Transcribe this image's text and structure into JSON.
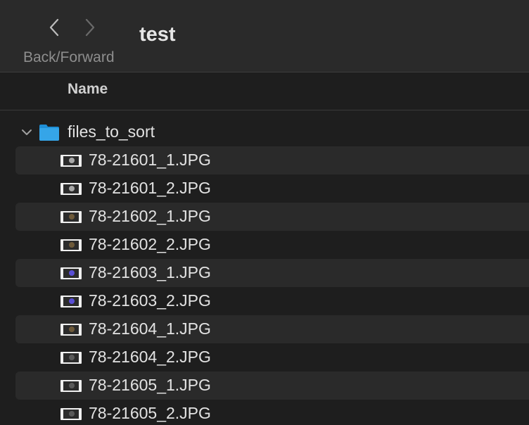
{
  "toolbar": {
    "back_icon": "chevron-left-icon",
    "forward_icon": "chevron-right-icon",
    "nav_caption": "Back/Forward",
    "title": "test"
  },
  "columns": {
    "name": "Name"
  },
  "folder": {
    "name": "files_to_sort",
    "expanded": true,
    "icon": "folder-icon",
    "color": "#35a5e8"
  },
  "files": [
    {
      "name": "78-21601_1.JPG",
      "thumb_color": "#a8a8a8"
    },
    {
      "name": "78-21601_2.JPG",
      "thumb_color": "#a8a8a8"
    },
    {
      "name": "78-21602_1.JPG",
      "thumb_color": "#6e5a3a"
    },
    {
      "name": "78-21602_2.JPG",
      "thumb_color": "#6e5a3a"
    },
    {
      "name": "78-21603_1.JPG",
      "thumb_color": "#5a4fd6"
    },
    {
      "name": "78-21603_2.JPG",
      "thumb_color": "#5a4fd6"
    },
    {
      "name": "78-21604_1.JPG",
      "thumb_color": "#6e5a3a"
    },
    {
      "name": "78-21604_2.JPG",
      "thumb_color": "#5a5a5a"
    },
    {
      "name": "78-21605_1.JPG",
      "thumb_color": "#5a5a5a"
    },
    {
      "name": "78-21605_2.JPG",
      "thumb_color": "#5a5a5a"
    }
  ]
}
